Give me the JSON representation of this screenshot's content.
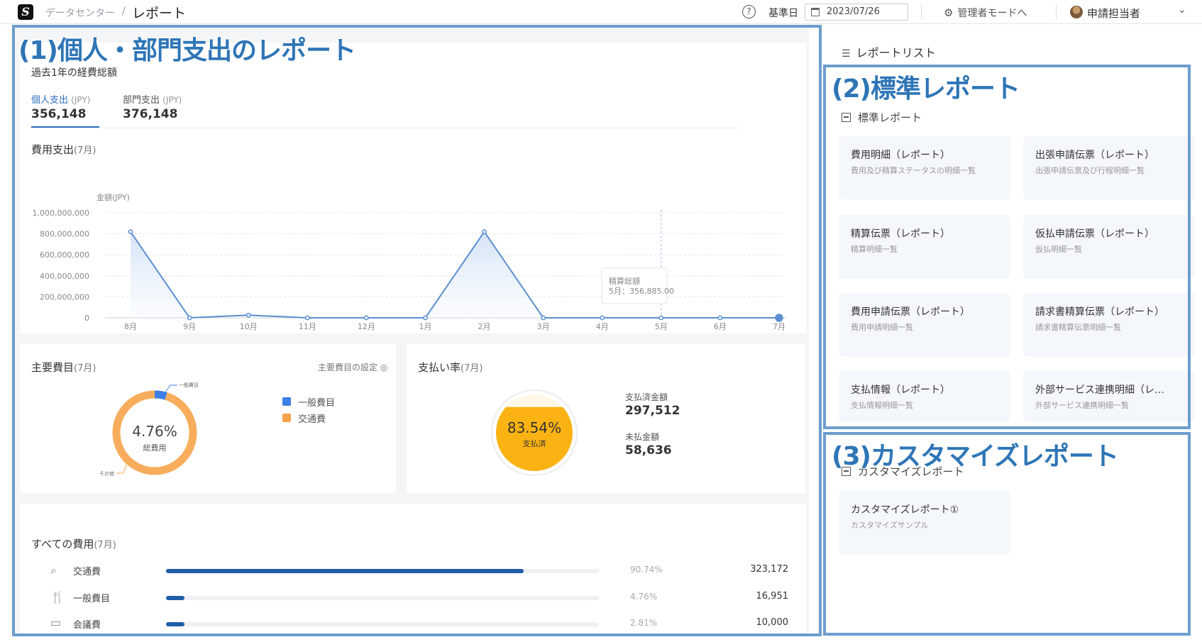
{
  "header": {
    "breadcrumb_parent": "データセンター",
    "breadcrumb_sep": "/",
    "breadcrumb_current": "レポート",
    "help_glyph": "?",
    "base_date_label": "基準日",
    "base_date_value": "2023/07/26",
    "admin_mode_link": "管理者モードへ",
    "user_name": "申請担当者"
  },
  "annotations": {
    "a1": "(1)個人・部門支出のレポート",
    "a2": "(2)標準レポート",
    "a3": "(3)カスタマイズレポート"
  },
  "summary": {
    "title": "過去1年の経費総額",
    "personal_label": "個人支出",
    "personal_unit": "(JPY)",
    "personal_value": "356,148",
    "dept_label": "部門支出",
    "dept_unit": "(JPY)",
    "dept_value": "376,148"
  },
  "expense_chart": {
    "title": "費用支出",
    "title_sub": "(7月)",
    "y_unit": "金額(JPY)",
    "tooltip_label": "精算総額",
    "tooltip_value": "5月：356,885.00"
  },
  "chart_data": {
    "type": "area",
    "categories": [
      "8月",
      "9月",
      "10月",
      "11月",
      "12月",
      "1月",
      "2月",
      "3月",
      "4月",
      "5月",
      "6月",
      "7月"
    ],
    "values": [
      820000000,
      0,
      25000000,
      0,
      0,
      0,
      820000000,
      0,
      0,
      356885,
      0,
      0
    ],
    "ylim": [
      0,
      1000000000
    ],
    "yticks": [
      "1,000,000,000",
      "800,000,000",
      "600,000,000",
      "400,000,000",
      "200,000,000",
      "0"
    ],
    "grid": true,
    "color": "#5b8fd0"
  },
  "major_expenses": {
    "title": "主要費目",
    "title_sub": "(7月)",
    "settings_link": "主要費目の設定",
    "center_value": "4.76%",
    "center_label": "総費用",
    "callout_top": "一般費目",
    "callout_bottom": "その他",
    "general_pct": 4.76,
    "legend": [
      {
        "label": "一般費目",
        "color": "#3d7fe6"
      },
      {
        "label": "交通費",
        "color": "#f5a24b"
      }
    ]
  },
  "payment_rate": {
    "title": "支払い率",
    "title_sub": "(7月)",
    "gauge_value": "83.54%",
    "gauge_label": "支払済",
    "gauge_fraction": 0.8354,
    "paid_label": "支払済金額",
    "paid_value": "297,512",
    "unpaid_label": "未払金額",
    "unpaid_value": "58,636"
  },
  "all_expenses": {
    "title": "すべての費用",
    "title_sub": "(7月)",
    "items": [
      {
        "icon": "search-icon",
        "name": "交通費",
        "pct": "90.74%",
        "amount": "323,172",
        "ratio": 0.9074
      },
      {
        "icon": "utensils-icon",
        "name": "一般費目",
        "pct": "4.76%",
        "amount": "16,951",
        "ratio": 0.0476
      },
      {
        "icon": "folder-icon",
        "name": "会議費",
        "pct": "2.81%",
        "amount": "10,000",
        "ratio": 0.0281
      }
    ]
  },
  "report_list": {
    "title": "レポートリスト",
    "standard_group": "標準レポート",
    "standard_reports": [
      {
        "title": "費用明細（レポート）",
        "desc": "費用及び精算ステータスの明細一覧"
      },
      {
        "title": "出張申請伝票（レポート）",
        "desc": "出張申請伝票及び行程明細一覧"
      },
      {
        "title": "精算伝票（レポート）",
        "desc": "精算明細一覧"
      },
      {
        "title": "仮払申請伝票（レポート）",
        "desc": "仮払明細一覧"
      },
      {
        "title": "費用申請伝票（レポート）",
        "desc": "費用申請明細一覧"
      },
      {
        "title": "請求書精算伝票（レポート）",
        "desc": "請求書精算伝票明細一覧"
      },
      {
        "title": "支払情報（レポート）",
        "desc": "支払情報明細一覧"
      },
      {
        "title": "外部サービス連携明細（レ…",
        "desc": "外部サービス連携明細一覧"
      }
    ],
    "custom_group": "カスタマイズレポート",
    "custom_reports": [
      {
        "title": "カスタマイズレポート①",
        "desc": "カスタマイズサンプル"
      }
    ]
  }
}
